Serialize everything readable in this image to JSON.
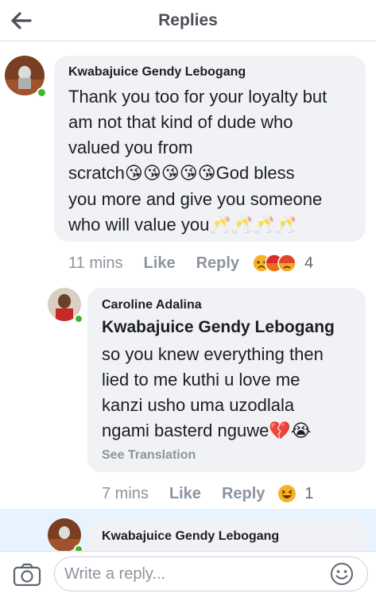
{
  "header": {
    "title": "Replies",
    "back_icon": "arrow-left-icon"
  },
  "comments": [
    {
      "author": "Kwabajuice Gendy Lebogang",
      "online": true,
      "lines": [
        "Thank you too for your loyalty but",
        "am not that kind of dude who",
        "valued you from",
        "scratch",
        "God bless",
        "you more and give you someone",
        "who will value you"
      ],
      "emojis": {
        "kiss": "😘😘😘😘😘",
        "cheers": "🥂🥂🥂🥂"
      },
      "time": "11 mins",
      "like_label": "Like",
      "reply_label": "Reply",
      "reactions": [
        "sad-icon",
        "angry-icon",
        "angry-icon"
      ],
      "reaction_count": "4"
    },
    {
      "author": "Caroline Adalina",
      "online": true,
      "mention": "Kwabajuice Gendy Lebogang",
      "lines": [
        "so you knew everything then",
        "lied to me kuthi u love me",
        "kanzi usho uma uzodlala",
        "ngami basterd nguwe"
      ],
      "emojis": {
        "end": "💔😭"
      },
      "see_translation": "See Translation",
      "time": "7 mins",
      "like_label": "Like",
      "reply_label": "Reply",
      "reactions": [
        "haha-icon"
      ],
      "reaction_count": "1"
    },
    {
      "author": "Kwabajuice Gendy Lebogang",
      "online": true
    }
  ],
  "composer": {
    "placeholder": "Write a reply...",
    "camera_icon": "camera-icon",
    "emoji_icon": "smiley-icon"
  },
  "colors": {
    "bubble": "#f0f2f5",
    "meta_text": "#8d949e",
    "online": "#42b72a",
    "highlight": "#e7f3ff"
  }
}
